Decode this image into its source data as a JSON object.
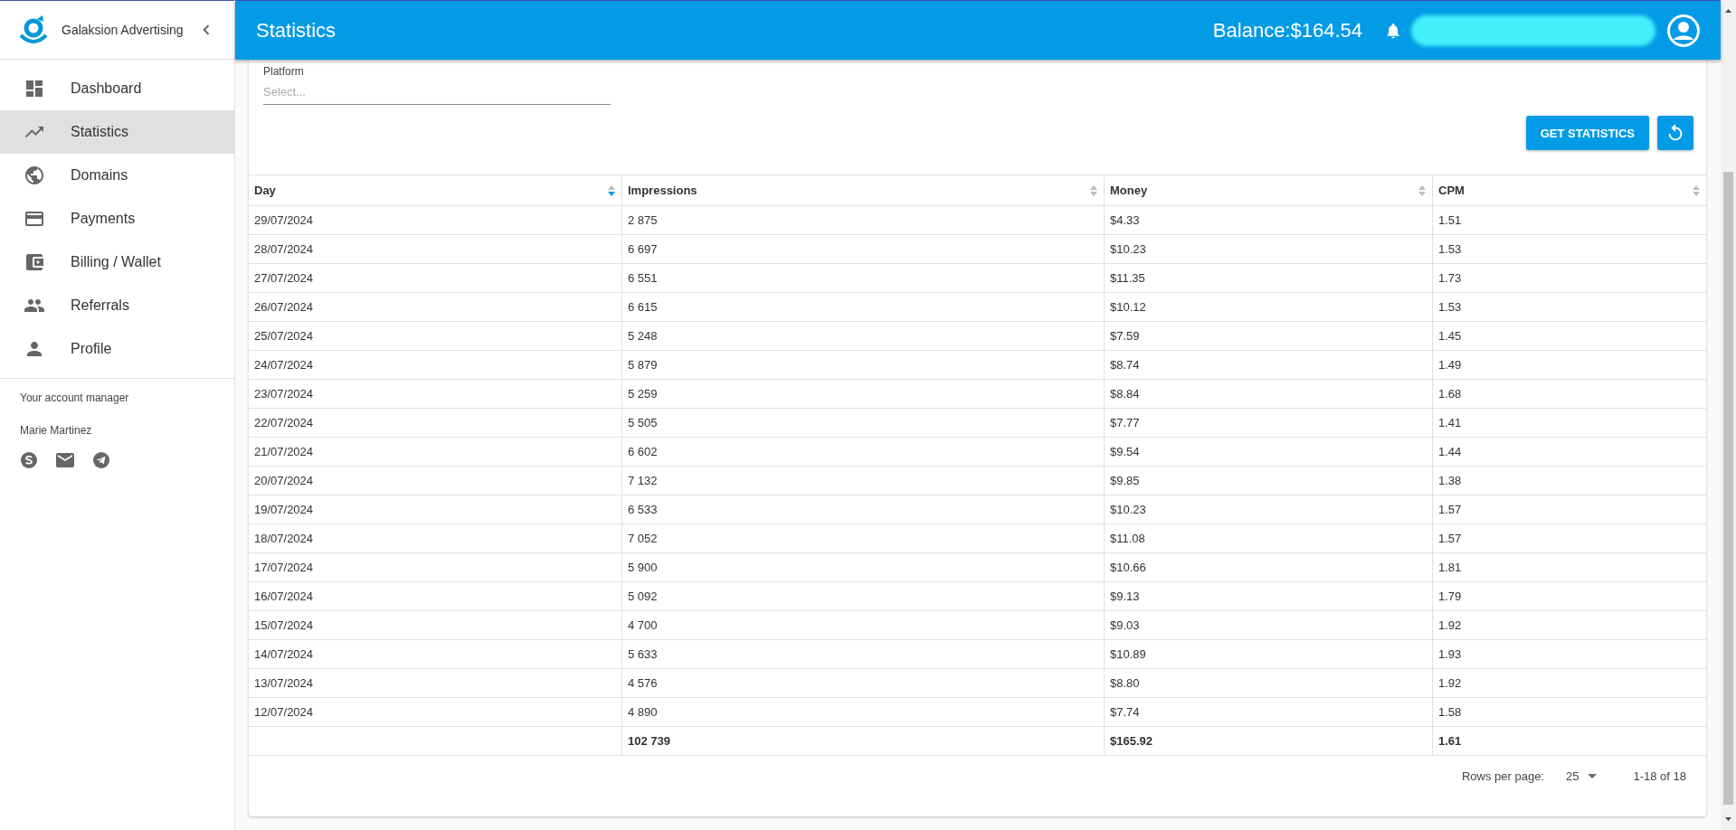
{
  "sidebar": {
    "brand": "Galaksion Advertising",
    "items": [
      {
        "label": "Dashboard",
        "selected": false
      },
      {
        "label": "Statistics",
        "selected": true
      },
      {
        "label": "Domains",
        "selected": false
      },
      {
        "label": "Payments",
        "selected": false
      },
      {
        "label": "Billing / Wallet",
        "selected": false
      },
      {
        "label": "Referrals",
        "selected": false
      },
      {
        "label": "Profile",
        "selected": false
      }
    ],
    "manager_title": "Your account manager",
    "manager_name": "Marie Martinez"
  },
  "header": {
    "title": "Statistics",
    "balance": "Balance:$164.54"
  },
  "filter": {
    "label": "Platform",
    "placeholder": "Select..."
  },
  "buttons": {
    "get_statistics": "GET STATISTICS"
  },
  "table": {
    "columns": [
      {
        "label": "Day",
        "sorted": true
      },
      {
        "label": "Impressions",
        "sorted": false
      },
      {
        "label": "Money",
        "sorted": false
      },
      {
        "label": "CPM",
        "sorted": false
      }
    ],
    "rows": [
      [
        "29/07/2024",
        "2 875",
        "$4.33",
        "1.51"
      ],
      [
        "28/07/2024",
        "6 697",
        "$10.23",
        "1.53"
      ],
      [
        "27/07/2024",
        "6 551",
        "$11.35",
        "1.73"
      ],
      [
        "26/07/2024",
        "6 615",
        "$10.12",
        "1.53"
      ],
      [
        "25/07/2024",
        "5 248",
        "$7.59",
        "1.45"
      ],
      [
        "24/07/2024",
        "5 879",
        "$8.74",
        "1.49"
      ],
      [
        "23/07/2024",
        "5 259",
        "$8.84",
        "1.68"
      ],
      [
        "22/07/2024",
        "5 505",
        "$7.77",
        "1.41"
      ],
      [
        "21/07/2024",
        "6 602",
        "$9.54",
        "1.44"
      ],
      [
        "20/07/2024",
        "7 132",
        "$9.85",
        "1.38"
      ],
      [
        "19/07/2024",
        "6 533",
        "$10.23",
        "1.57"
      ],
      [
        "18/07/2024",
        "7 052",
        "$11.08",
        "1.57"
      ],
      [
        "17/07/2024",
        "5 900",
        "$10.66",
        "1.81"
      ],
      [
        "16/07/2024",
        "5 092",
        "$9.13",
        "1.79"
      ],
      [
        "15/07/2024",
        "4 700",
        "$9.03",
        "1.92"
      ],
      [
        "14/07/2024",
        "5 633",
        "$10.89",
        "1.93"
      ],
      [
        "13/07/2024",
        "4 576",
        "$8.80",
        "1.92"
      ],
      [
        "12/07/2024",
        "4 890",
        "$7.74",
        "1.58"
      ]
    ],
    "totals": [
      "102 739",
      "$165.92",
      "1.61"
    ]
  },
  "pagination": {
    "rows_per_page_label": "Rows per page:",
    "rows_per_page": "25",
    "range": "1-18 of 18"
  }
}
